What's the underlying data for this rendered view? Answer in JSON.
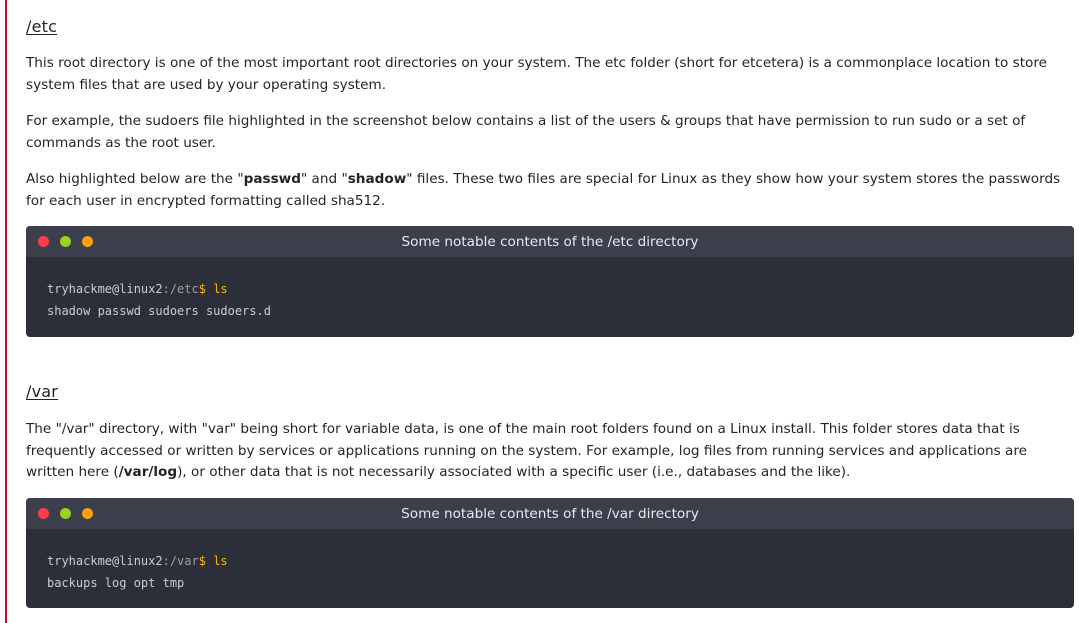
{
  "accent": "#b3121f",
  "window_dot_colors": [
    "#ff3b47",
    "#9ad319",
    "#ff9f0a"
  ],
  "sections": [
    {
      "title": "/etc",
      "paragraphs": [
        [
          "This root directory is one of the most important root directories on your system. The etc folder (short for etcetera) is a commonplace location to store system files that are used by your operating system."
        ],
        [
          "For example, the sudoers file highlighted in the screenshot below contains a list of the users & groups that have permission to run sudo or a set of commands as the root user."
        ],
        [
          "Also highlighted below are the \"",
          "passwd",
          "\" and \"",
          "shadow",
          "\" files. These two files are special for Linux as they show how your system stores the passwords for each user in encrypted formatting called sha512."
        ]
      ],
      "terminal": {
        "title": "Some notable contents of the /etc directory",
        "prompt_user": "tryhackme@linux2",
        "prompt_path": ":/etc",
        "prompt_symbol": "$",
        "command": "ls",
        "output": "shadow passwd sudoers sudoers.d"
      }
    },
    {
      "title": "/var",
      "paragraphs": [
        [
          "The \"/var\" directory, with \"var\" being short for variable data,  is one of the main root folders found on a Linux install. This folder stores data that is frequently accessed or written by services or applications running on the system. For example, log files from running services and applications are written here (",
          "/var/log",
          "), or other data that is not necessarily associated with a specific user (i.e., databases and the like)."
        ]
      ],
      "terminal": {
        "title": "Some notable contents of the /var directory",
        "prompt_user": "tryhackme@linux2",
        "prompt_path": ":/var",
        "prompt_symbol": "$",
        "command": "ls",
        "output": "backups log opt tmp"
      }
    }
  ]
}
